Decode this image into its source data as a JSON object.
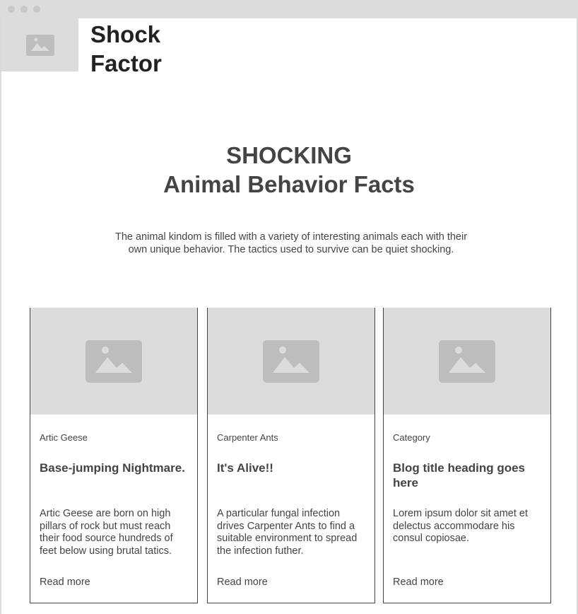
{
  "brand": {
    "line1": "Shock",
    "line2": "Factor"
  },
  "hero": {
    "line1": "SHOCKING",
    "line2": "Animal Behavior Facts",
    "intro": "The animal kindom is filled with a variety of interesting animals each with their own unique behavior. The tactics used to survive can be quiet shocking."
  },
  "cards": [
    {
      "category": "Artic Geese",
      "title": "Base-jumping Nightmare.",
      "body": "Artic Geese are born on high pillars of rock but must reach their food source hundreds of feet below using brutal tatics.",
      "link": "Read more"
    },
    {
      "category": "Carpenter Ants",
      "title": "It's Alive!!",
      "body": "A particular fungal infection drives Carpenter Ants to find a suitable environment to spread the infection futher.",
      "link": "Read more"
    },
    {
      "category": "Category",
      "title": "Blog title heading goes here",
      "body": "Lorem ipsum dolor sit amet et delectus accommodare his consul copiosae.",
      "link": "Read more"
    }
  ],
  "colors": {
    "placeholder_bg": "#dcdcdc",
    "placeholder_icon": "#bdbdbd",
    "text": "#444444"
  }
}
